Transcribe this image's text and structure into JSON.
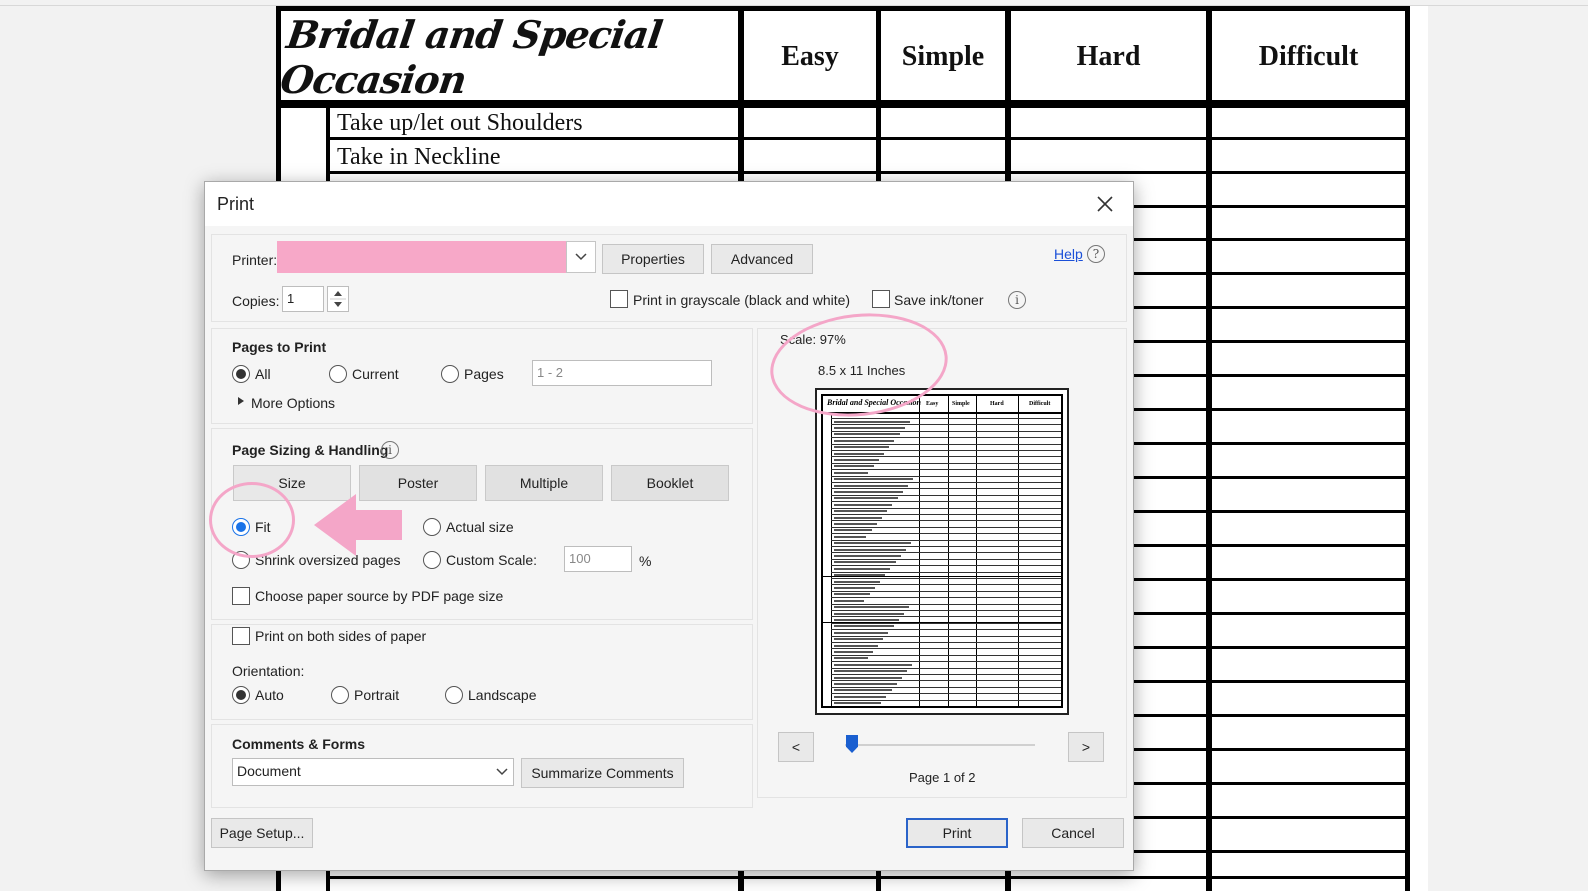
{
  "document": {
    "title": "Bridal and Special Occasion",
    "columns": [
      "Easy",
      "Simple",
      "Hard",
      "Difficult"
    ],
    "rows": [
      "Take up/let out Shoulders",
      "Take in Neckline"
    ]
  },
  "dialog": {
    "title": "Print",
    "printer": {
      "label": "Printer:",
      "value": "",
      "properties_button": "Properties",
      "advanced_button": "Advanced",
      "help_link": "Help"
    },
    "copies": {
      "label": "Copies:",
      "value": "1"
    },
    "grayscale": {
      "label": "Print in grayscale (black and white)",
      "checked": false
    },
    "save_ink": {
      "label": "Save ink/toner",
      "checked": false
    },
    "pages_to_print": {
      "header": "Pages to Print",
      "options": [
        "All",
        "Current",
        "Pages"
      ],
      "selected": "All",
      "pages_placeholder": "1 - 2",
      "more_options": "More Options"
    },
    "page_sizing": {
      "header": "Page Sizing & Handling",
      "tabs": [
        "Size",
        "Poster",
        "Multiple",
        "Booklet"
      ],
      "fit": "Fit",
      "actual_size": "Actual size",
      "shrink": "Shrink oversized pages",
      "custom_scale": "Custom Scale:",
      "custom_scale_value": "100",
      "percent": "%",
      "paper_source": "Choose paper source by PDF page size",
      "selected": "Fit"
    },
    "both_sides": "Print on both sides of paper",
    "orientation": {
      "label": "Orientation:",
      "options": [
        "Auto",
        "Portrait",
        "Landscape"
      ],
      "selected": "Auto"
    },
    "comments_forms": {
      "header": "Comments & Forms",
      "value": "Document",
      "summarize_button": "Summarize Comments"
    },
    "preview": {
      "scale": "Scale:  97%",
      "paper_size": "8.5 x 11 Inches",
      "page_indicator": "Page 1 of 2",
      "prev": "<",
      "next": ">",
      "slider_position": 0.0
    },
    "page_setup_button": "Page Setup...",
    "print_button": "Print",
    "cancel_button": "Cancel"
  },
  "colors": {
    "annotation_pink": "#f4a6c8",
    "printer_redaction": "#f7a8c8",
    "accent_blue": "#1a73e8"
  }
}
